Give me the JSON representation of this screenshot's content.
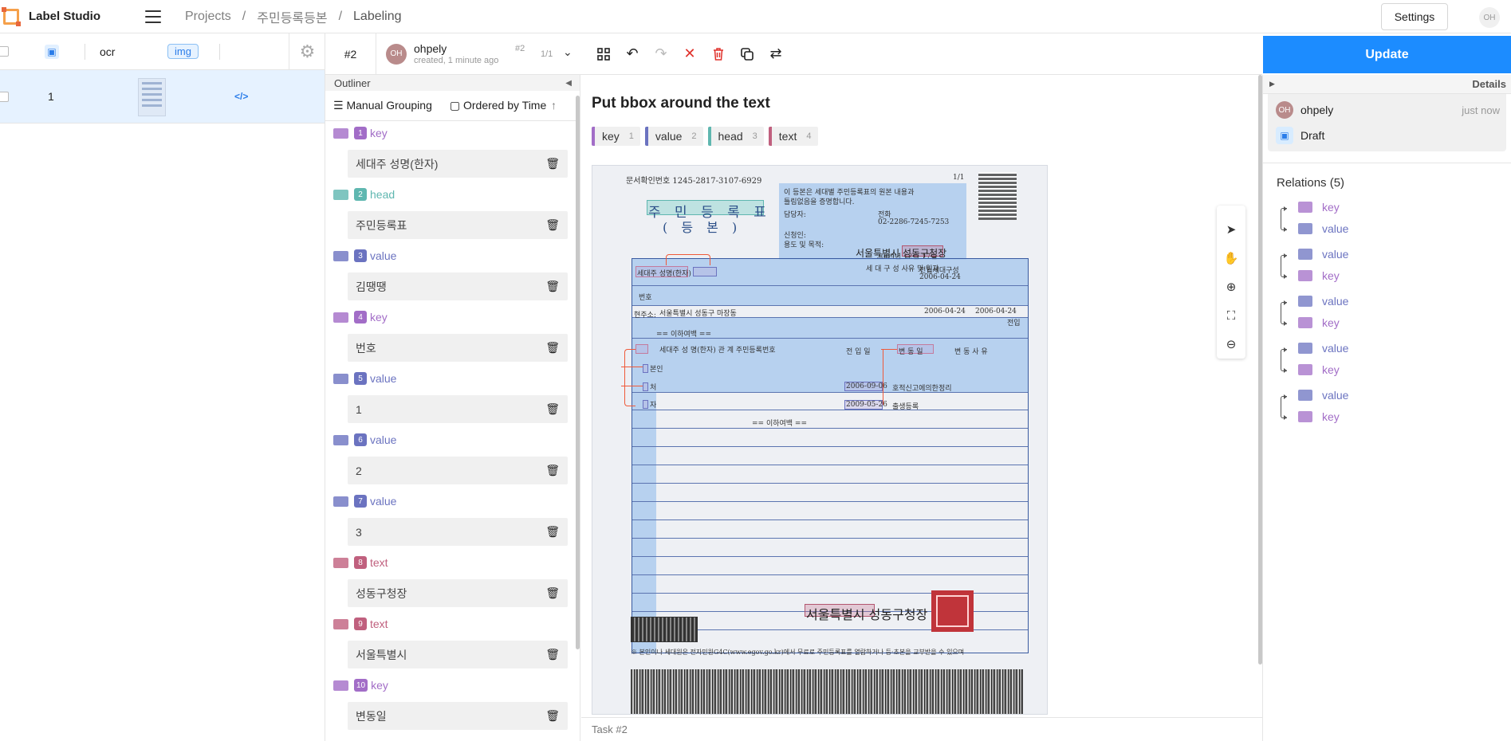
{
  "header": {
    "app_name": "Label Studio",
    "breadcrumbs": [
      "Projects",
      "주민등록등본",
      "Labeling"
    ],
    "settings_label": "Settings",
    "user_initials": "OH"
  },
  "tasks": {
    "columns": {
      "ocr": "ocr",
      "img": "img"
    },
    "rows": [
      {
        "id": "1"
      }
    ]
  },
  "annotation": {
    "task_id": "#2",
    "user": "ohpely",
    "created": "created, 1 minute ago",
    "annotation_hash": "#2",
    "count": "1/1",
    "initials": "OH",
    "tools": [
      "grid-icon",
      "undo-icon",
      "redo-icon",
      "reject-icon",
      "delete-icon",
      "copy-icon",
      "swap-icon"
    ]
  },
  "outliner": {
    "title": "Outliner",
    "grouping": "Manual Grouping",
    "ordering": "Ordered by Time",
    "regions": [
      {
        "num": "1",
        "label": "key",
        "color": "#a26dc7",
        "text": "세대주 성명(한자)"
      },
      {
        "num": "2",
        "label": "head",
        "color": "#5fb7b0",
        "text": "주민등록표"
      },
      {
        "num": "3",
        "label": "value",
        "color": "#6b73c0",
        "text": "김땡땡"
      },
      {
        "num": "4",
        "label": "key",
        "color": "#a26dc7",
        "text": "번호"
      },
      {
        "num": "5",
        "label": "value",
        "color": "#6b73c0",
        "text": "1"
      },
      {
        "num": "6",
        "label": "value",
        "color": "#6b73c0",
        "text": "2"
      },
      {
        "num": "7",
        "label": "value",
        "color": "#6b73c0",
        "text": "3"
      },
      {
        "num": "8",
        "label": "text",
        "color": "#c0607e",
        "text": "성동구청장"
      },
      {
        "num": "9",
        "label": "text",
        "color": "#c0607e",
        "text": "서울특별시"
      },
      {
        "num": "10",
        "label": "key",
        "color": "#a26dc7",
        "text": "변동일"
      }
    ]
  },
  "canvas": {
    "title": "Put bbox around the text",
    "labels": [
      {
        "name": "key",
        "hotkey": "1",
        "color": "#a26dc7"
      },
      {
        "name": "value",
        "hotkey": "2",
        "color": "#6b73c0"
      },
      {
        "name": "head",
        "hotkey": "3",
        "color": "#5fb7b0"
      },
      {
        "name": "text",
        "hotkey": "4",
        "color": "#c0607e"
      }
    ],
    "footer": "Task #2",
    "doc": {
      "doc_no": "문서확인번호  1245-2817-3107-6929",
      "page": "1/1",
      "title": "주 민 등 록 표",
      "subtitle": "( 등 본 )",
      "notice1": "이 등본은 세대별 주민등록표의 원본 내용과",
      "notice2": "틀림없음을 증명합니다.",
      "manager": "담당자:",
      "phone_label": "전화",
      "phone": "02-2286-7245-7253",
      "applicant": "신청인:",
      "purpose": "용도 및 목적:",
      "date": "2009년 12월 17일",
      "issuer": "서울특별시 성동구청장",
      "head_key": "세대주 성명(한자)",
      "household": "세 대 구 성 사유 및 일자",
      "household_val": "전입세대구성",
      "household_date": "2006-04-24",
      "number_key": "번호",
      "address_key": "현주소:",
      "address": "서울특별시 성동구 마장동",
      "move_date": "2006-04-24",
      "move_date2": "2006-04-24",
      "move_reason": "전입",
      "below_blank": "== 이하여백 ==",
      "member_header": "세대주 성 명(한자) 관 계 주민등록번호",
      "moved_in_key": "전 입 일",
      "change_key": "변 동 일",
      "change_reason_key": "변 동 사 유",
      "rel1": "본인",
      "rel2": "처",
      "rel3": "자",
      "change1": "2006-09-06",
      "reason1": "호적신고에의한정리",
      "change2": "2009-05-26",
      "reason2": "출생등록",
      "footer_issuer": "서울특별시  성동구청장",
      "footer_note": "※ 본인이나 세대원은 전자민원G4C(www.egov.go.kr)에서 무료로 주민등록표를 열람하거나 등·초본을 교부받을 수 있으며"
    }
  },
  "details": {
    "title": "Details",
    "user": "ohpely",
    "initials": "OH",
    "time": "just now",
    "status": "Draft",
    "relations_title": "Relations (5)",
    "relations": [
      {
        "from": "key",
        "from_color": "#a26dc7",
        "to": "value",
        "to_color": "#6b73c0"
      },
      {
        "from": "value",
        "from_color": "#6b73c0",
        "to": "key",
        "to_color": "#a26dc7"
      },
      {
        "from": "value",
        "from_color": "#6b73c0",
        "to": "key",
        "to_color": "#a26dc7"
      },
      {
        "from": "value",
        "from_color": "#6b73c0",
        "to": "key",
        "to_color": "#a26dc7"
      },
      {
        "from": "value",
        "from_color": "#6b73c0",
        "to": "key",
        "to_color": "#a26dc7"
      }
    ]
  },
  "update_label": "Update"
}
